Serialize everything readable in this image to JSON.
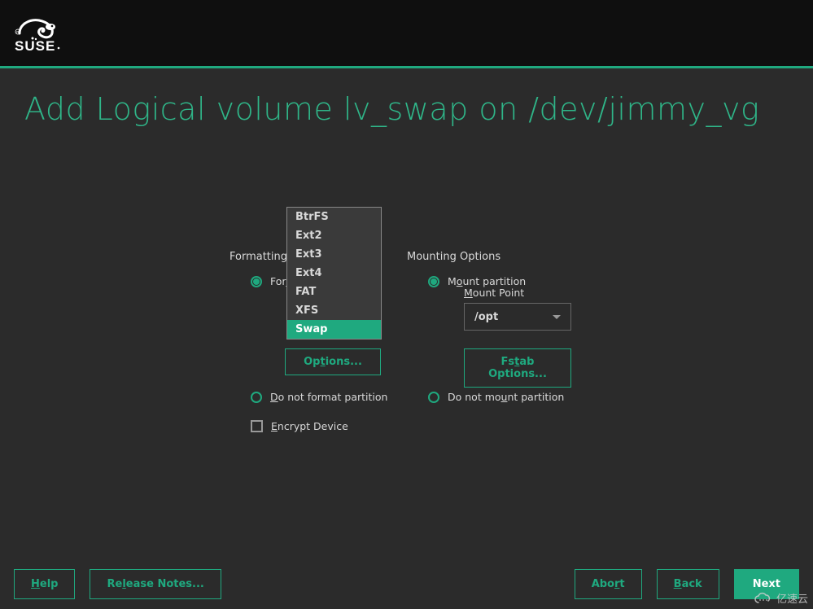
{
  "brand": "SUSE",
  "title": "Add Logical volume lv_swap on /dev/jimmy_vg",
  "format": {
    "section_label": "Formatting Options",
    "format_label": "Format partition",
    "noformat_label": "Do not format partition",
    "encrypt_label": "Encrypt Device",
    "options_btn": "Options...",
    "filesystems": [
      "BtrFS",
      "Ext2",
      "Ext3",
      "Ext4",
      "FAT",
      "XFS",
      "Swap"
    ],
    "selected_fs": "Swap",
    "format_selected": true
  },
  "mount": {
    "section_label": "Mounting Options",
    "mount_label": "Mount partition",
    "point_label": "Mount Point",
    "point_value": "/opt",
    "fstab_btn": "Fstab Options...",
    "nomount_label": "Do not mount partition",
    "mount_selected": true
  },
  "footer": {
    "help": "Help",
    "release_notes": "Release Notes...",
    "abort": "Abort",
    "back": "Back",
    "next": "Next"
  },
  "watermark": "亿速云"
}
